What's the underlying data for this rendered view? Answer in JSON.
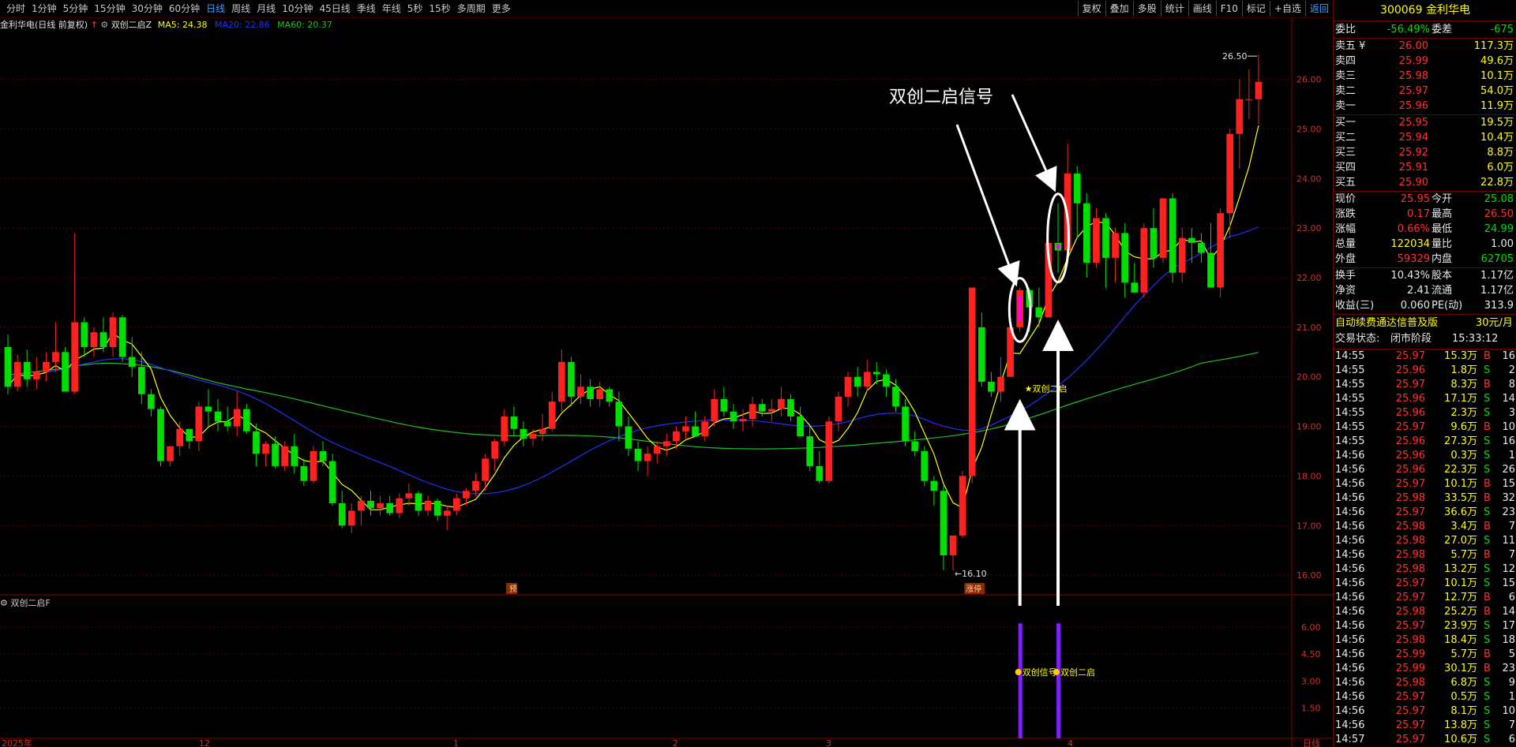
{
  "toolbar": {
    "periods": [
      "分时",
      "1分钟",
      "5分钟",
      "15分钟",
      "30分钟",
      "60分钟",
      "日线",
      "周线",
      "月线",
      "10分钟",
      "45日线",
      "季线",
      "年线",
      "5秒",
      "15秒",
      "多周期",
      "更多"
    ],
    "active_period": "日线",
    "right_buttons": [
      "复权",
      "叠加",
      "多股",
      "统计",
      "画线",
      "F10",
      "标记",
      "+自选",
      "返回"
    ]
  },
  "chart_header": {
    "title": "金利华电(日线 前复权)",
    "indicator": "双创二启Z",
    "ma5": "MA5: 24.38",
    "ma20": "MA20: 22.86",
    "ma60": "MA60: 20.37"
  },
  "colors": {
    "up": "#ff2020",
    "down": "#00e000",
    "ma5": "#ffff00",
    "ma20": "#2030ff",
    "ma60": "#20c020",
    "signal": "#ff00ff",
    "bar_purple": "#8020ff",
    "annot": "#ffffff"
  },
  "chart_data": {
    "type": "candlestick",
    "ylim": [
      15.7,
      26.9
    ],
    "y_ticks": [
      "26.00",
      "25.00",
      "24.00",
      "23.00",
      "22.00",
      "21.00",
      "20.00",
      "19.00",
      "18.00",
      "17.00",
      "16.00"
    ],
    "candles": [
      [
        20.6,
        20.85,
        19.65,
        19.8
      ],
      [
        19.8,
        20.45,
        19.7,
        20.3
      ],
      [
        20.3,
        20.55,
        19.8,
        19.95
      ],
      [
        19.95,
        20.4,
        19.75,
        20.1
      ],
      [
        20.1,
        20.5,
        19.9,
        20.3
      ],
      [
        20.3,
        21.1,
        20.1,
        20.5
      ],
      [
        20.5,
        20.6,
        19.7,
        19.7
      ],
      [
        19.7,
        22.9,
        19.65,
        21.1
      ],
      [
        21.1,
        21.2,
        20.4,
        20.6
      ],
      [
        20.6,
        21.0,
        20.4,
        20.9
      ],
      [
        20.9,
        21.2,
        20.5,
        20.6
      ],
      [
        20.6,
        21.3,
        20.4,
        21.2
      ],
      [
        21.2,
        21.25,
        20.3,
        20.4
      ],
      [
        20.4,
        20.8,
        20.0,
        20.2
      ],
      [
        20.2,
        20.5,
        19.45,
        19.65
      ],
      [
        19.65,
        19.75,
        19.2,
        19.35
      ],
      [
        19.35,
        19.4,
        18.2,
        18.3
      ],
      [
        18.3,
        18.6,
        18.2,
        18.6
      ],
      [
        18.6,
        19.1,
        18.4,
        18.95
      ],
      [
        18.95,
        18.95,
        18.55,
        18.7
      ],
      [
        18.7,
        19.5,
        18.5,
        19.4
      ],
      [
        19.4,
        19.75,
        19.0,
        19.3
      ],
      [
        19.3,
        19.55,
        18.9,
        19.1
      ],
      [
        19.1,
        19.4,
        18.9,
        19.0
      ],
      [
        19.0,
        19.7,
        18.8,
        19.35
      ],
      [
        19.35,
        19.45,
        18.85,
        18.9
      ],
      [
        18.9,
        19.05,
        18.2,
        18.45
      ],
      [
        18.45,
        18.7,
        18.2,
        18.65
      ],
      [
        18.65,
        18.8,
        18.15,
        18.2
      ],
      [
        18.2,
        18.7,
        18.1,
        18.6
      ],
      [
        18.6,
        18.85,
        18.05,
        18.2
      ],
      [
        18.2,
        18.35,
        17.8,
        17.9
      ],
      [
        17.9,
        18.6,
        17.85,
        18.5
      ],
      [
        18.5,
        18.7,
        18.2,
        18.3
      ],
      [
        18.3,
        18.45,
        17.4,
        17.45
      ],
      [
        17.45,
        17.7,
        16.95,
        17.0
      ],
      [
        17.0,
        17.45,
        16.85,
        17.3
      ],
      [
        17.3,
        17.6,
        17.0,
        17.5
      ],
      [
        17.5,
        17.7,
        17.2,
        17.35
      ],
      [
        17.35,
        17.6,
        17.2,
        17.45
      ],
      [
        17.45,
        17.6,
        17.2,
        17.25
      ],
      [
        17.25,
        17.65,
        17.15,
        17.55
      ],
      [
        17.55,
        17.85,
        17.4,
        17.65
      ],
      [
        17.65,
        17.7,
        17.2,
        17.3
      ],
      [
        17.3,
        17.6,
        17.2,
        17.5
      ],
      [
        17.5,
        17.55,
        17.1,
        17.2
      ],
      [
        17.2,
        17.4,
        16.9,
        17.3
      ],
      [
        17.3,
        17.65,
        17.2,
        17.55
      ],
      [
        17.55,
        17.75,
        17.4,
        17.7
      ],
      [
        17.7,
        18.05,
        17.6,
        17.9
      ],
      [
        17.9,
        18.45,
        17.7,
        18.35
      ],
      [
        18.35,
        18.75,
        18.1,
        18.7
      ],
      [
        18.7,
        19.35,
        18.6,
        19.2
      ],
      [
        19.2,
        19.4,
        18.8,
        18.95
      ],
      [
        18.95,
        19.1,
        18.6,
        18.75
      ],
      [
        18.75,
        18.95,
        18.6,
        18.85
      ],
      [
        18.85,
        19.25,
        18.7,
        18.95
      ],
      [
        18.95,
        19.7,
        18.9,
        19.5
      ],
      [
        19.5,
        20.55,
        19.3,
        20.3
      ],
      [
        20.3,
        20.4,
        19.4,
        19.6
      ],
      [
        19.6,
        20.05,
        19.45,
        19.8
      ],
      [
        19.8,
        19.95,
        19.4,
        19.55
      ],
      [
        19.55,
        19.9,
        19.4,
        19.75
      ],
      [
        19.75,
        19.8,
        19.4,
        19.5
      ],
      [
        19.5,
        19.7,
        18.7,
        19.0
      ],
      [
        19.0,
        19.2,
        18.4,
        18.55
      ],
      [
        18.55,
        18.7,
        18.1,
        18.3
      ],
      [
        18.3,
        18.6,
        18.0,
        18.45
      ],
      [
        18.45,
        18.7,
        18.25,
        18.6
      ],
      [
        18.6,
        18.85,
        18.4,
        18.7
      ],
      [
        18.7,
        19.0,
        18.55,
        18.9
      ],
      [
        18.9,
        19.2,
        18.75,
        19.0
      ],
      [
        19.0,
        19.3,
        18.8,
        18.8
      ],
      [
        18.8,
        19.2,
        18.7,
        19.1
      ],
      [
        19.1,
        19.75,
        19.0,
        19.55
      ],
      [
        19.55,
        19.8,
        19.2,
        19.3
      ],
      [
        19.3,
        19.45,
        18.95,
        19.1
      ],
      [
        19.1,
        19.35,
        18.9,
        19.15
      ],
      [
        19.15,
        19.6,
        19.0,
        19.45
      ],
      [
        19.45,
        19.55,
        19.2,
        19.3
      ],
      [
        19.3,
        19.55,
        19.1,
        19.35
      ],
      [
        19.35,
        19.8,
        19.2,
        19.55
      ],
      [
        19.55,
        19.65,
        19.1,
        19.2
      ],
      [
        19.2,
        19.4,
        18.9,
        18.8
      ],
      [
        18.8,
        19.0,
        18.1,
        18.2
      ],
      [
        18.2,
        18.5,
        17.85,
        17.9
      ],
      [
        17.9,
        19.2,
        17.85,
        19.1
      ],
      [
        19.1,
        19.7,
        18.9,
        19.6
      ],
      [
        19.6,
        20.1,
        19.4,
        20.0
      ],
      [
        20.0,
        20.2,
        19.6,
        19.8
      ],
      [
        19.8,
        20.35,
        19.7,
        20.1
      ],
      [
        20.1,
        20.3,
        19.85,
        20.05
      ],
      [
        20.05,
        20.15,
        19.6,
        19.8
      ],
      [
        19.8,
        19.95,
        19.3,
        19.4
      ],
      [
        19.4,
        19.55,
        18.6,
        18.7
      ],
      [
        18.7,
        18.9,
        18.4,
        18.5
      ],
      [
        18.5,
        18.6,
        17.8,
        17.9
      ],
      [
        17.9,
        18.0,
        17.4,
        17.7
      ],
      [
        17.7,
        17.8,
        16.1,
        16.4
      ],
      [
        16.4,
        16.6,
        16.1,
        16.8
      ],
      [
        16.8,
        18.1,
        16.75,
        18.0
      ],
      [
        18.0,
        21.8,
        17.85,
        21.8
      ],
      [
        21.0,
        21.3,
        19.8,
        19.9
      ],
      [
        19.9,
        20.1,
        19.6,
        19.7
      ],
      [
        19.7,
        20.4,
        19.5,
        20.0
      ],
      [
        20.0,
        21.1,
        20.0,
        21.0
      ],
      [
        21.0,
        21.8,
        20.9,
        21.75
      ],
      [
        21.75,
        21.8,
        20.9,
        21.4
      ],
      [
        21.4,
        21.8,
        21.0,
        21.2
      ],
      [
        21.2,
        22.7,
        21.2,
        22.7
      ],
      [
        22.7,
        23.5,
        22.1,
        22.55
      ],
      [
        22.55,
        24.7,
        22.5,
        24.1
      ],
      [
        24.1,
        24.25,
        22.8,
        23.5
      ],
      [
        23.5,
        23.7,
        22.0,
        22.3
      ],
      [
        22.3,
        23.4,
        22.2,
        23.2
      ],
      [
        23.2,
        23.3,
        21.8,
        22.4
      ],
      [
        22.4,
        23.0,
        21.9,
        22.9
      ],
      [
        22.9,
        23.1,
        21.6,
        21.9
      ],
      [
        21.9,
        22.3,
        21.7,
        21.7
      ],
      [
        21.7,
        23.1,
        21.6,
        23.0
      ],
      [
        23.0,
        23.4,
        22.2,
        22.4
      ],
      [
        22.4,
        23.6,
        22.3,
        23.6
      ],
      [
        23.6,
        23.7,
        21.9,
        22.1
      ],
      [
        22.1,
        23.0,
        21.9,
        22.8
      ],
      [
        22.8,
        23.0,
        22.3,
        22.7
      ],
      [
        22.7,
        22.9,
        22.3,
        22.5
      ],
      [
        22.5,
        23.1,
        21.8,
        21.8
      ],
      [
        21.8,
        23.4,
        21.6,
        23.3
      ],
      [
        23.3,
        25.0,
        22.8,
        24.9
      ],
      [
        24.9,
        26.0,
        24.2,
        25.6
      ],
      [
        25.6,
        26.2,
        25.2,
        25.6
      ],
      [
        25.6,
        26.5,
        25.1,
        25.95
      ]
    ],
    "signal_candles": [
      106,
      110
    ],
    "ma5_label": "MA5",
    "ma20_label": "MA20",
    "ma60_label": "MA60",
    "high_label": "26.50",
    "low_label": "16.10",
    "event_labels": [
      "预",
      "涨停"
    ],
    "signal_text": "★双创二启",
    "annotation": "双创二启信号",
    "x_labels": [
      "2025年",
      "12",
      "1",
      "2",
      "3",
      "4",
      "日线"
    ],
    "sub_panel": {
      "title": "双创二启F",
      "ylim": [
        0,
        7
      ],
      "y_ticks": [
        "6.00",
        "4.50",
        "3.00",
        "1.50"
      ],
      "bars": [
        106,
        110
      ],
      "bar_value": 6.2,
      "labels": [
        "双创信号",
        "双创二启"
      ]
    }
  },
  "quote": {
    "code": "300069",
    "name": "金利华电",
    "weibi_label": "委比",
    "weibi": "-56.49%",
    "weicha_label": "委差",
    "weicha": "-675",
    "sell": [
      {
        "label": "卖五 ¥",
        "price": "26.00",
        "vol": "117.3万"
      },
      {
        "label": "卖四",
        "price": "25.99",
        "vol": "49.6万"
      },
      {
        "label": "卖三",
        "price": "25.98",
        "vol": "10.1万"
      },
      {
        "label": "卖二",
        "price": "25.97",
        "vol": "54.0万"
      },
      {
        "label": "卖一",
        "price": "25.96",
        "vol": "11.9万"
      }
    ],
    "buy": [
      {
        "label": "买一",
        "price": "25.95",
        "vol": "19.5万"
      },
      {
        "label": "买二",
        "price": "25.94",
        "vol": "10.4万"
      },
      {
        "label": "买三",
        "price": "25.92",
        "vol": "8.8万"
      },
      {
        "label": "买四",
        "price": "25.91",
        "vol": "6.0万"
      },
      {
        "label": "买五",
        "price": "25.90",
        "vol": "22.8万"
      }
    ],
    "stats": [
      {
        "l1": "现价",
        "v1": "25.95",
        "c1": "red",
        "l2": "今开",
        "v2": "25.08",
        "c2": "grn"
      },
      {
        "l1": "涨跌",
        "v1": "0.17",
        "c1": "red",
        "l2": "最高",
        "v2": "26.50",
        "c2": "red"
      },
      {
        "l1": "涨幅",
        "v1": "0.66%",
        "c1": "red",
        "l2": "最低",
        "v2": "24.99",
        "c2": "grn"
      },
      {
        "l1": "总量",
        "v1": "122034",
        "c1": "yel",
        "l2": "量比",
        "v2": "1.00",
        "c2": "wht"
      },
      {
        "l1": "外盘",
        "v1": "59329",
        "c1": "red",
        "l2": "内盘",
        "v2": "62705",
        "c2": "grn"
      }
    ],
    "stats2": [
      {
        "l1": "换手",
        "v1": "10.43%",
        "l2": "股本",
        "v2": "1.17亿"
      },
      {
        "l1": "净资",
        "v1": "2.41",
        "l2": "流通",
        "v2": "1.17亿"
      },
      {
        "l1": "收益(三)",
        "v1": "0.060",
        "l2": "PE(动)",
        "v2": "313.9"
      }
    ],
    "promo": "自动续费通达信普及版",
    "promo_price": "30元/月",
    "status_label": "交易状态:",
    "status": "闭市阶段",
    "status_time": "15:33:12"
  },
  "ticks": [
    [
      "14:55",
      "25.97",
      "15.3万",
      "B",
      "16"
    ],
    [
      "14:55",
      "25.96",
      "1.8万",
      "S",
      "2"
    ],
    [
      "14:55",
      "25.97",
      "8.3万",
      "B",
      "8"
    ],
    [
      "14:55",
      "25.96",
      "17.1万",
      "S",
      "14"
    ],
    [
      "14:55",
      "25.96",
      "2.3万",
      "S",
      "3"
    ],
    [
      "14:55",
      "25.97",
      "9.6万",
      "B",
      "10"
    ],
    [
      "14:55",
      "25.96",
      "27.3万",
      "S",
      "16"
    ],
    [
      "14:56",
      "25.96",
      "0.3万",
      "S",
      "1"
    ],
    [
      "14:56",
      "25.96",
      "22.3万",
      "S",
      "26"
    ],
    [
      "14:56",
      "25.97",
      "10.1万",
      "B",
      "15"
    ],
    [
      "14:56",
      "25.98",
      "33.5万",
      "B",
      "32"
    ],
    [
      "14:56",
      "25.97",
      "36.6万",
      "S",
      "23"
    ],
    [
      "14:56",
      "25.98",
      "3.4万",
      "B",
      "7"
    ],
    [
      "14:56",
      "25.98",
      "27.0万",
      "S",
      "11"
    ],
    [
      "14:56",
      "25.98",
      "5.7万",
      "B",
      "7"
    ],
    [
      "14:56",
      "25.98",
      "13.2万",
      "S",
      "12"
    ],
    [
      "14:56",
      "25.97",
      "10.1万",
      "S",
      "15"
    ],
    [
      "14:56",
      "25.97",
      "12.7万",
      "B",
      "6"
    ],
    [
      "14:56",
      "25.98",
      "25.2万",
      "B",
      "14"
    ],
    [
      "14:56",
      "25.97",
      "23.9万",
      "S",
      "17"
    ],
    [
      "14:56",
      "25.98",
      "18.4万",
      "S",
      "18"
    ],
    [
      "14:56",
      "25.99",
      "5.7万",
      "B",
      "5"
    ],
    [
      "14:56",
      "25.99",
      "30.1万",
      "B",
      "23"
    ],
    [
      "14:56",
      "25.98",
      "6.8万",
      "S",
      "9"
    ],
    [
      "14:56",
      "25.97",
      "0.5万",
      "S",
      "1"
    ],
    [
      "14:56",
      "25.97",
      "8.1万",
      "S",
      "10"
    ],
    [
      "14:56",
      "25.97",
      "13.8万",
      "S",
      "7"
    ],
    [
      "14:57",
      "25.97",
      "10.6万",
      "S",
      "6"
    ]
  ]
}
